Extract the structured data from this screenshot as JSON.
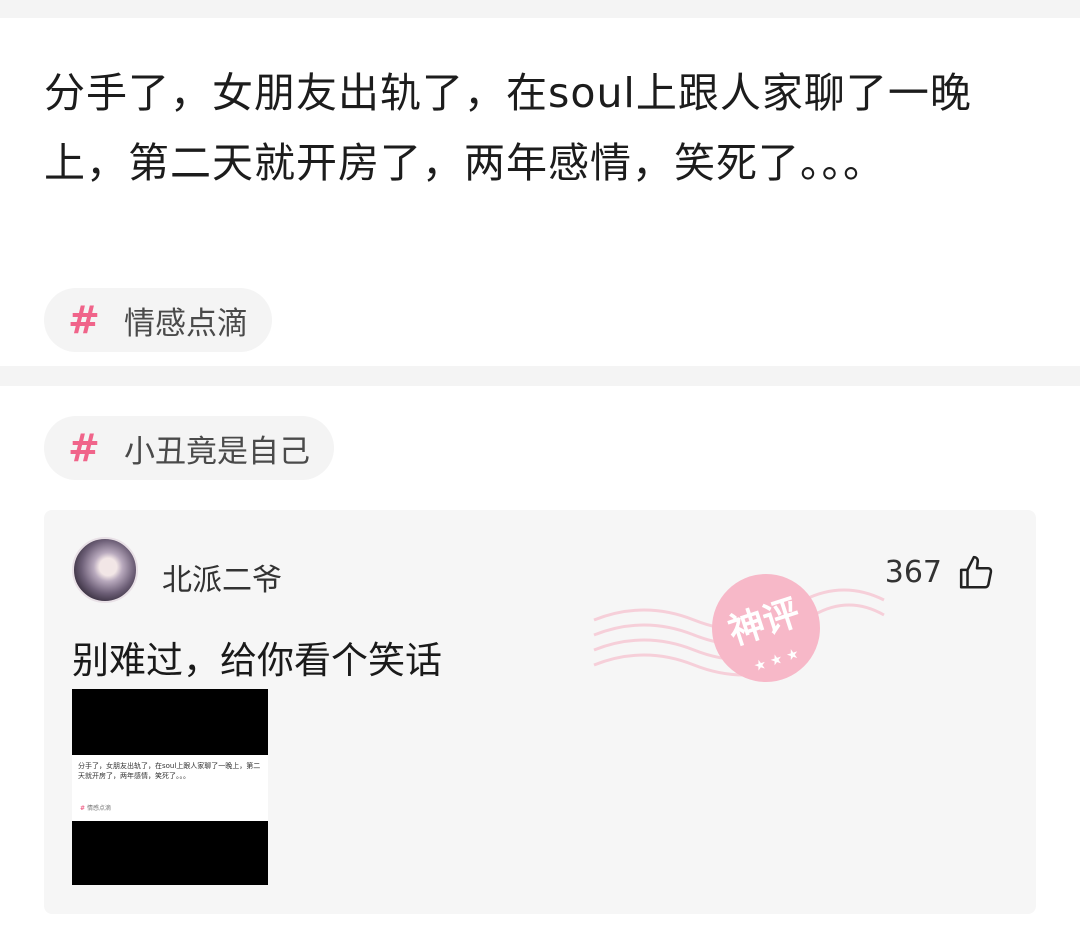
{
  "post": {
    "text": "分手了，女朋友出轨了，在soul上跟人家聊了一晚上，第二天就开房了，两年感情，笑死了。。。",
    "tag": "情感点滴"
  },
  "topic_tag": "小丑竟是自己",
  "comment": {
    "username": "北派二爷",
    "likes": "367",
    "text": "别难过，给你看个笑话",
    "stamp_text": "神评"
  },
  "attachment": {
    "text": "分手了，女朋友出轨了，在soul上跟人家聊了一晚上，第二天就开房了，两年感情，笑死了。。。",
    "tag": "情感点滴"
  },
  "colors": {
    "accent": "#f0648a",
    "stamp": "#f7b8c8"
  }
}
